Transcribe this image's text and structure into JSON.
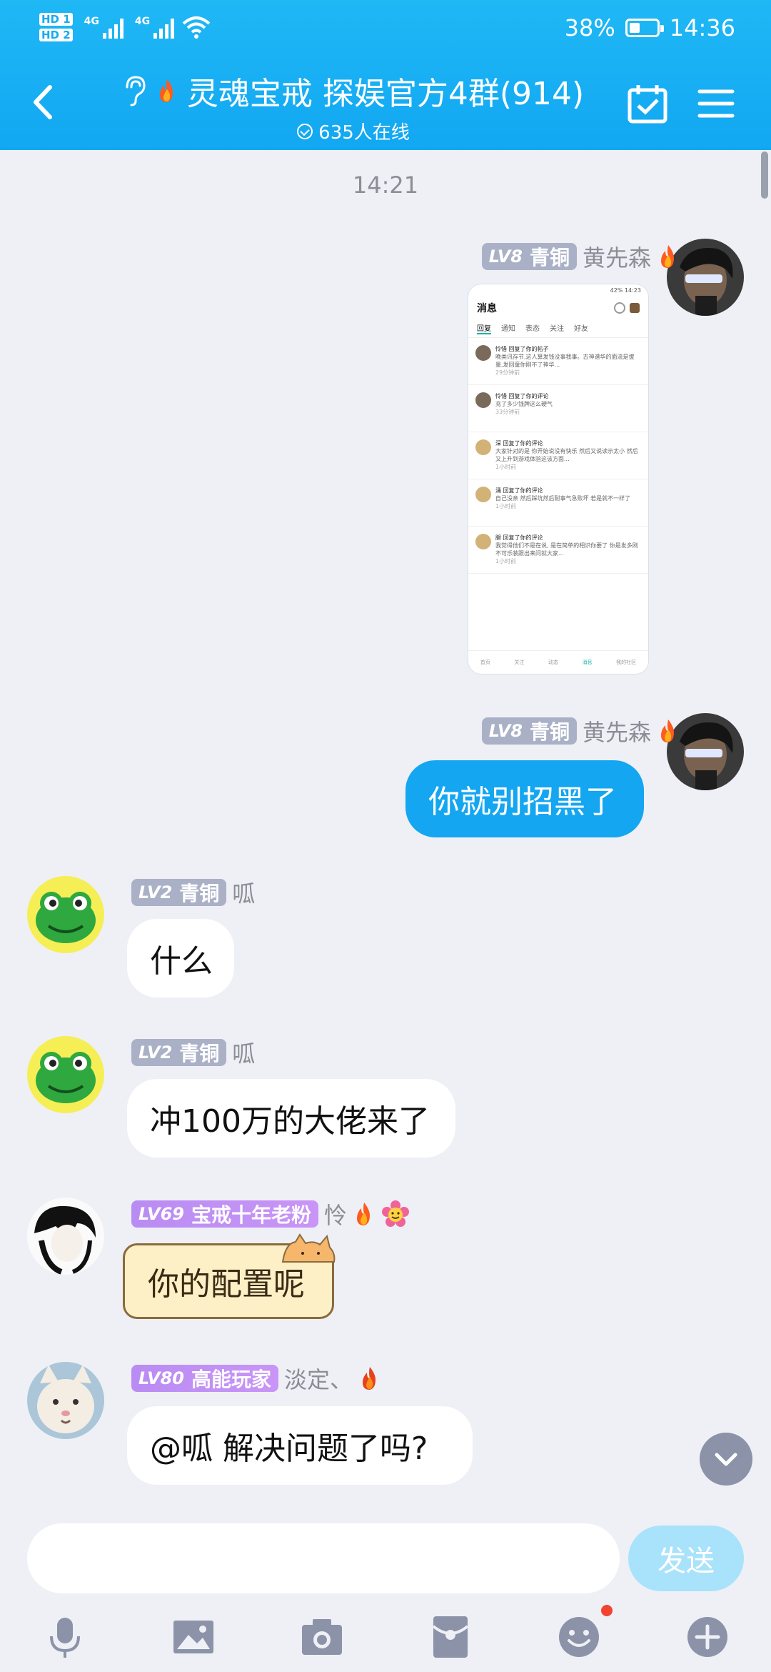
{
  "status_bar": {
    "hd1": "HD 1",
    "hd2": "HD 2",
    "net1": "4G",
    "net2": "4G",
    "battery": "38%",
    "battery_level": 0.38,
    "time": "14:36"
  },
  "header": {
    "title": "灵魂宝戒 探娱官方4群(914)",
    "online": "635人在线"
  },
  "chat": {
    "timestamp": "14:21",
    "messages": [
      {
        "sender": "黄先森",
        "level": "LV8",
        "rank": "青铜",
        "text": ""
      },
      {
        "sender": "黄先森",
        "level": "LV8",
        "rank": "青铜",
        "text": "你就别招黑了"
      },
      {
        "sender": "呱",
        "level": "LV2",
        "rank": "青铜",
        "text": "什么"
      },
      {
        "sender": "呱",
        "level": "LV2",
        "rank": "青铜",
        "text": "冲100万的大佬来了"
      },
      {
        "sender": "怜",
        "level": "LV69",
        "rank": "宝戒十年老粉",
        "text": "你的配置呢"
      },
      {
        "sender": "淡定、",
        "level": "LV80",
        "rank": "高能玩家",
        "text": "@呱 解决问题了吗?"
      }
    ]
  },
  "shared_screenshot": {
    "status_left": "",
    "status_right": "42%  14:23",
    "title": "消息",
    "tabs": [
      "回复",
      "通知",
      "表态",
      "关注",
      "好友"
    ],
    "items": [
      {
        "name": "怜惜 回复了你的帖子",
        "body": "晚类讯存节,这人算发钱没事我事。古神谱华的面流是拔量,发回童你刚不了神华...",
        "time": "29分钟前"
      },
      {
        "name": "怜惜 回复了你的评论",
        "body": "充了多少钱牌这么硬气",
        "time": "33分钟前"
      },
      {
        "name": "深 回复了你的评论",
        "body": "大家针对的是 你开始说没有快乐 然后又说读示太小 然后又上升到游戏体验这该方面...",
        "time": "1小时前"
      },
      {
        "name": "涌 回复了你的评论",
        "body": "自己没亲 然后踩坑然后耐事气急败坏 若是就不一样了",
        "time": "1小时前"
      },
      {
        "name": "腿 回复了你的评论",
        "body": "我觉得他们不是在说, 是在简单的相识你要了 你是发多刚不可乐装跟出来问就大家...",
        "time": "1小时前"
      }
    ],
    "nav": [
      "首页",
      "关注",
      "动态",
      "消息",
      "我的社区"
    ]
  },
  "input": {
    "placeholder": "",
    "send_label": "发送"
  },
  "colors": {
    "header": "#12a7f2",
    "bubble_out": "#14a6f1",
    "bubble_in": "#ffffff",
    "background": "#eef0f6",
    "level_gray": "#aab1c7",
    "level_purple": "#c995f6"
  },
  "icons": {
    "back": "chevron-left-icon",
    "ear": "ear-icon",
    "fire": "fire-icon",
    "calendar": "calendar-check-icon",
    "menu": "menu-icon",
    "mic": "mic-icon",
    "image": "image-icon",
    "camera": "camera-icon",
    "redpacket": "red-packet-icon",
    "emoji": "emoji-icon",
    "plus": "plus-icon"
  }
}
